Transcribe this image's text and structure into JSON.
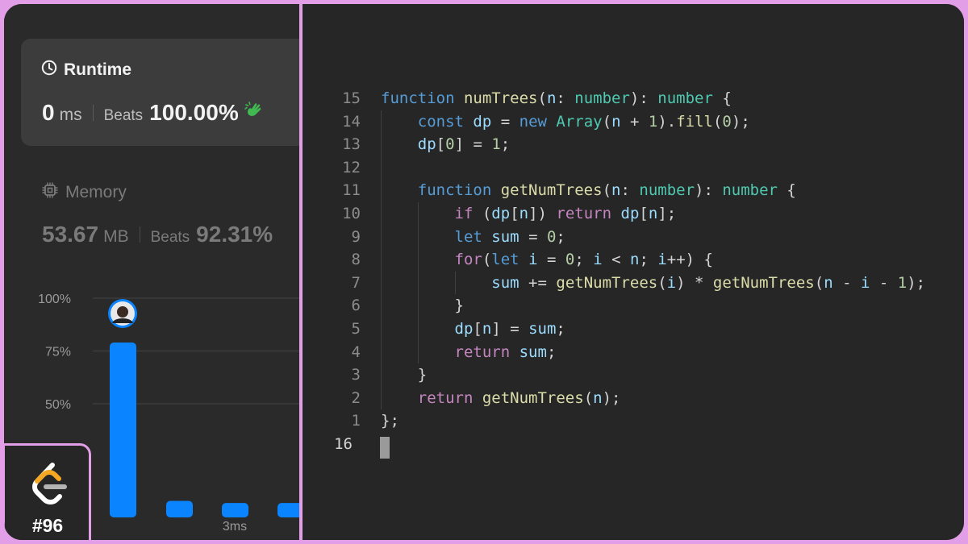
{
  "runtime": {
    "title": "Runtime",
    "value": "0",
    "unit": "ms",
    "beats_label": "Beats",
    "beats_value": "100.00%",
    "clap_color": "#3fb950"
  },
  "memory": {
    "title": "Memory",
    "value": "53.67",
    "unit": "MB",
    "beats_label": "Beats",
    "beats_value": "92.31%"
  },
  "chart_data": {
    "type": "bar",
    "y_ticks": [
      "100%",
      "75%",
      "50%"
    ],
    "ylim": [
      0,
      100
    ],
    "values": [
      79,
      4,
      3,
      3
    ],
    "x_label": "3ms",
    "bar_color": "#0a84ff",
    "grid": true
  },
  "badge": {
    "label": "#96",
    "logo_icon": "leetcode-logo-icon"
  },
  "editor": {
    "lines": [
      {
        "n": "15",
        "tokens": [
          [
            "kw-blue",
            "function"
          ],
          [
            "plain",
            " "
          ],
          [
            "fn",
            "numTrees"
          ],
          [
            "plain",
            "("
          ],
          [
            "var",
            "n"
          ],
          [
            "plain",
            ": "
          ],
          [
            "type",
            "number"
          ],
          [
            "plain",
            "): "
          ],
          [
            "type",
            "number"
          ],
          [
            "plain",
            " {"
          ]
        ]
      },
      {
        "n": "14",
        "tokens": [
          [
            "plain",
            "    "
          ],
          [
            "kw-blue",
            "const"
          ],
          [
            "plain",
            " "
          ],
          [
            "var",
            "dp"
          ],
          [
            "plain",
            " = "
          ],
          [
            "kw-blue",
            "new"
          ],
          [
            "plain",
            " "
          ],
          [
            "type",
            "Array"
          ],
          [
            "plain",
            "("
          ],
          [
            "var",
            "n"
          ],
          [
            "plain",
            " + "
          ],
          [
            "num",
            "1"
          ],
          [
            "plain",
            ")."
          ],
          [
            "fn",
            "fill"
          ],
          [
            "plain",
            "("
          ],
          [
            "num",
            "0"
          ],
          [
            "plain",
            ");"
          ]
        ]
      },
      {
        "n": "13",
        "tokens": [
          [
            "plain",
            "    "
          ],
          [
            "var",
            "dp"
          ],
          [
            "plain",
            "["
          ],
          [
            "num",
            "0"
          ],
          [
            "plain",
            "] = "
          ],
          [
            "num",
            "1"
          ],
          [
            "plain",
            ";"
          ]
        ]
      },
      {
        "n": "12",
        "tokens": []
      },
      {
        "n": "11",
        "tokens": [
          [
            "plain",
            "    "
          ],
          [
            "kw-blue",
            "function"
          ],
          [
            "plain",
            " "
          ],
          [
            "fn",
            "getNumTrees"
          ],
          [
            "plain",
            "("
          ],
          [
            "var",
            "n"
          ],
          [
            "plain",
            ": "
          ],
          [
            "type",
            "number"
          ],
          [
            "plain",
            "): "
          ],
          [
            "type",
            "number"
          ],
          [
            "plain",
            " {"
          ]
        ]
      },
      {
        "n": "10",
        "tokens": [
          [
            "plain",
            "        "
          ],
          [
            "kw-purple",
            "if"
          ],
          [
            "plain",
            " ("
          ],
          [
            "var",
            "dp"
          ],
          [
            "plain",
            "["
          ],
          [
            "var",
            "n"
          ],
          [
            "plain",
            "]) "
          ],
          [
            "kw-purple",
            "return"
          ],
          [
            "plain",
            " "
          ],
          [
            "var",
            "dp"
          ],
          [
            "plain",
            "["
          ],
          [
            "var",
            "n"
          ],
          [
            "plain",
            "];"
          ]
        ]
      },
      {
        "n": "9",
        "tokens": [
          [
            "plain",
            "        "
          ],
          [
            "kw-blue",
            "let"
          ],
          [
            "plain",
            " "
          ],
          [
            "var",
            "sum"
          ],
          [
            "plain",
            " = "
          ],
          [
            "num",
            "0"
          ],
          [
            "plain",
            ";"
          ]
        ]
      },
      {
        "n": "8",
        "tokens": [
          [
            "plain",
            "        "
          ],
          [
            "kw-purple",
            "for"
          ],
          [
            "plain",
            "("
          ],
          [
            "kw-blue",
            "let"
          ],
          [
            "plain",
            " "
          ],
          [
            "var",
            "i"
          ],
          [
            "plain",
            " = "
          ],
          [
            "num",
            "0"
          ],
          [
            "plain",
            "; "
          ],
          [
            "var",
            "i"
          ],
          [
            "plain",
            " < "
          ],
          [
            "var",
            "n"
          ],
          [
            "plain",
            "; "
          ],
          [
            "var",
            "i"
          ],
          [
            "plain",
            "++) {"
          ]
        ]
      },
      {
        "n": "7",
        "tokens": [
          [
            "plain",
            "            "
          ],
          [
            "var",
            "sum"
          ],
          [
            "plain",
            " += "
          ],
          [
            "fn",
            "getNumTrees"
          ],
          [
            "plain",
            "("
          ],
          [
            "var",
            "i"
          ],
          [
            "plain",
            ") * "
          ],
          [
            "fn",
            "getNumTrees"
          ],
          [
            "plain",
            "("
          ],
          [
            "var",
            "n"
          ],
          [
            "plain",
            " - "
          ],
          [
            "var",
            "i"
          ],
          [
            "plain",
            " - "
          ],
          [
            "num",
            "1"
          ],
          [
            "plain",
            ");"
          ]
        ]
      },
      {
        "n": "6",
        "tokens": [
          [
            "plain",
            "        }"
          ]
        ]
      },
      {
        "n": "5",
        "tokens": [
          [
            "plain",
            "        "
          ],
          [
            "var",
            "dp"
          ],
          [
            "plain",
            "["
          ],
          [
            "var",
            "n"
          ],
          [
            "plain",
            "] = "
          ],
          [
            "var",
            "sum"
          ],
          [
            "plain",
            ";"
          ]
        ]
      },
      {
        "n": "4",
        "tokens": [
          [
            "plain",
            "        "
          ],
          [
            "kw-purple",
            "return"
          ],
          [
            "plain",
            " "
          ],
          [
            "var",
            "sum"
          ],
          [
            "plain",
            ";"
          ]
        ]
      },
      {
        "n": "3",
        "tokens": [
          [
            "plain",
            "    }"
          ]
        ]
      },
      {
        "n": "2",
        "tokens": [
          [
            "plain",
            "    "
          ],
          [
            "kw-purple",
            "return"
          ],
          [
            "plain",
            " "
          ],
          [
            "fn",
            "getNumTrees"
          ],
          [
            "plain",
            "("
          ],
          [
            "var",
            "n"
          ],
          [
            "plain",
            ");"
          ]
        ]
      },
      {
        "n": "1",
        "tokens": [
          [
            "plain",
            "};"
          ]
        ]
      },
      {
        "n": "16",
        "tokens": [],
        "current": true
      }
    ]
  }
}
